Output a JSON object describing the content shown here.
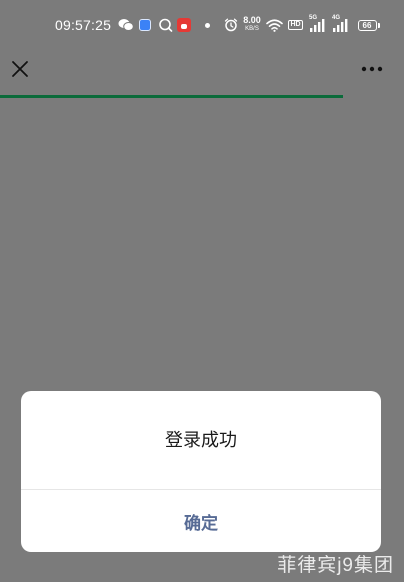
{
  "status_bar": {
    "time": "09:57:25",
    "net_speed_value": "8.00",
    "net_speed_unit": "KB/S",
    "hd_label": "HD",
    "signal_1_label": "5G",
    "signal_2_label": "4G",
    "battery_level": "66",
    "icons": [
      "wechat-icon",
      "app-blue-icon",
      "chat-bubble-icon",
      "app-red-icon",
      "dot-icon",
      "alarm-icon",
      "wifi-icon",
      "hd-icon",
      "signal-5g-icon",
      "signal-4g-icon",
      "battery-icon"
    ]
  },
  "nav": {
    "close_icon": "close-icon",
    "more_icon": "more-icon",
    "progress_percent": 85,
    "progress_color": "#0b6b3a"
  },
  "dialog": {
    "message": "登录成功",
    "confirm_label": "确定",
    "confirm_color": "#576b95"
  },
  "watermark": {
    "text": "菲律宾j9集团"
  }
}
